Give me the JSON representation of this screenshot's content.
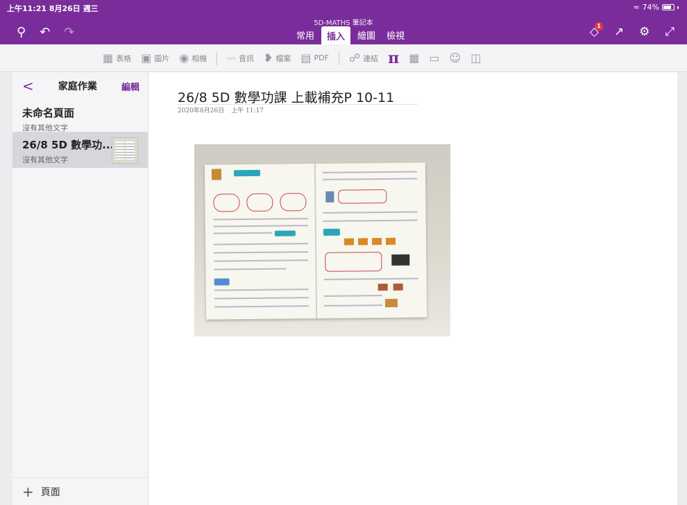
{
  "status": {
    "time": "上午11:21  8月26日 週三",
    "battery": "74%"
  },
  "app": {
    "notebook_title": "5D-MATHS 筆記本",
    "tabs": [
      {
        "label": "常用"
      },
      {
        "label": "插入"
      },
      {
        "label": "繪圖"
      },
      {
        "label": "檢視"
      }
    ],
    "notification_count": "1"
  },
  "toolbar": {
    "table": "表格",
    "picture": "圖片",
    "camera": "相機",
    "audio": "音訊",
    "file": "檔案",
    "pdf": "PDF",
    "link": "連結"
  },
  "sidebar": {
    "back_label": "<",
    "section_title": "家庭作業",
    "edit_label": "編輯",
    "pages": [
      {
        "title": "未命名頁面",
        "subtitle": "沒有其他文字"
      },
      {
        "title": "26/8 5D 數學功...",
        "subtitle": "沒有其他文字"
      }
    ],
    "add_page_label": "頁面"
  },
  "page": {
    "title": "26/8 5D 數學功課 上載補充P 10-11",
    "date": "2020年8月26日",
    "time": "上午 11:17"
  },
  "icons": {
    "search": "search-icon",
    "undo": "undo-icon",
    "redo": "redo-icon",
    "bell": "bell-icon",
    "share": "share-icon",
    "settings": "gear-icon",
    "expand": "expand-icon"
  },
  "colors": {
    "brand": "#7a2d9a",
    "badge": "#e23a3a"
  }
}
